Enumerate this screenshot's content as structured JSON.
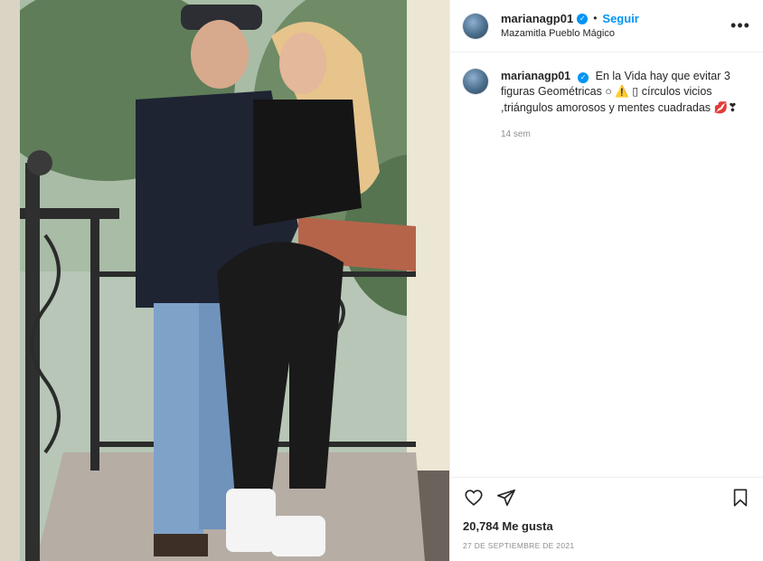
{
  "post": {
    "photo_alt": "photo",
    "username": "marianagp01",
    "follow_label": "Seguir",
    "dot": "•",
    "location": "Mazamitla Pueblo Mágico",
    "more_label": "•••",
    "caption": "En la Vida hay que evitar 3 figuras Geométricas ○ ⚠️ ▯ círculos vicios ,triángulos amorosos y mentes cuadradas 💋❣",
    "time_ago": "14 sem",
    "likes": "20,784 Me gusta",
    "date": "27 DE SEPTIEMBRE DE 2021"
  },
  "icons": {
    "verified": "verified-badge-icon",
    "like": "heart-icon",
    "share": "send-icon",
    "save": "bookmark-icon"
  },
  "colors": {
    "accent": "#0095f6",
    "text": "#262626",
    "muted": "#8e8e8e"
  }
}
